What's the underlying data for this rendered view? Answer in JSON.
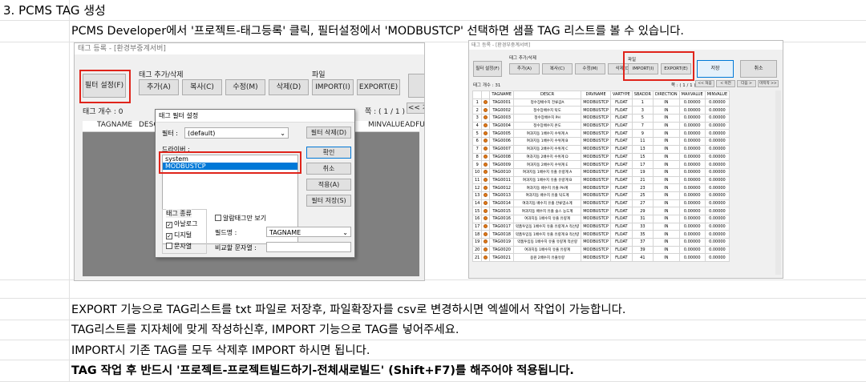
{
  "sheet": {
    "heading": "3. PCMS TAG 생성",
    "intro": "PCMS Developer에서 '프로젝트-태그등록' 클릭, 필터설정에서 'MODBUSTCP' 선택하면 샘플 TAG 리스트를 볼 수 있습니다.",
    "notes": [
      "EXPORT 기능으로 TAG리스트를 txt 파일로 저장후, 파일확장자를 csv로 변경하시면 엑셀에서 작업이 가능합니다.",
      "TAG리스트를 지자체에 맞게 작성하신후, IMPORT 기능으로 TAG를 넣어주세요.",
      "IMPORT시 기존 TAG를 모두 삭제후 IMPORT 하시면 됩니다.",
      "TAG 작업 후 반드시 '프로젝트-프로젝트빌드하기-전체새로빌드' (Shift+F7)를 해주어야 적용됩니다."
    ]
  },
  "shot1": {
    "window_title": "태그 등록 - [환경부중계서버]",
    "filter_button": "필터 설정(F)",
    "group_tag": "태그 추가/삭제",
    "btn_add": "추가(A)",
    "btn_copy": "복사(C)",
    "btn_edit": "수정(M)",
    "btn_delete": "삭제(D)",
    "group_file": "파일",
    "btn_import": "IMPORT(I)",
    "btn_export": "EXPORT(E)",
    "tag_count": "태그 개수 : 0",
    "page": "쪽 : ( 1 / 1 )",
    "first_btn": "<< 처",
    "col_tagname": "TAGNAME",
    "col_descr": "DESCR",
    "col_minvalue": "MINVALUE",
    "col_adfull": "ADFU",
    "dialog": {
      "title": "태그 필터 설정",
      "filter_label": "필터 :",
      "filter_value": "(default)",
      "btn_filter_delete": "필터 삭제(D)",
      "driver_label": "드라이버 :",
      "drivers": [
        "system",
        "MODBUSTCP"
      ],
      "btn_ok": "확인",
      "btn_cancel": "취소",
      "btn_apply": "적용(A)",
      "btn_filter_save": "필터 저장(S)",
      "tag_kind": "태그 종류",
      "kind_analog": "아날로그",
      "kind_digital": "디지털",
      "kind_string": "문자열",
      "alarm_only": "알람태그만 보기",
      "field_name_label": "필드명 :",
      "field_name_value": "TAGNAME",
      "compare_label": "비교할 문자열 :"
    }
  },
  "shot2": {
    "window_title": "태그 등록 - [환경부중계서버]",
    "filter_button": "필터 설정(F)",
    "group_tag": "태그 추가/삭제",
    "btn_add": "추가(A)",
    "btn_copy": "복사(C)",
    "btn_edit": "수정(M)",
    "btn_delete": "삭제(D)",
    "group_file": "파일",
    "btn_import": "IMPORT(I)",
    "btn_export": "EXPORT(E)",
    "btn_save": "저장",
    "btn_cancel": "취소",
    "tag_count": "태그 개수 : 31",
    "page": "쪽 : ( 1 / 1 )",
    "nav": [
      "<< 처음",
      "< 이전",
      "다음 >",
      "마지막 >>"
    ],
    "columns": [
      "",
      "",
      "TAGNAME",
      "DESCR",
      "DRVNAME",
      "VARTYPE",
      "SBADDR",
      "DIRECTION",
      "MAXVALUE",
      "MINVALUE"
    ],
    "rows": [
      [
        "1",
        "TAG0001",
        "정수장배수지 전류값A",
        "MODBUSTCP",
        "FLOAT",
        "1",
        "IN",
        "0.00000",
        "0.00000"
      ],
      [
        "2",
        "TAG0002",
        "정수장배수지 탁도",
        "MODBUSTCP",
        "FLOAT",
        "3",
        "IN",
        "0.00000",
        "0.00000"
      ],
      [
        "3",
        "TAG0003",
        "정수장배수지 PH",
        "MODBUSTCP",
        "FLOAT",
        "5",
        "IN",
        "0.00000",
        "0.00000"
      ],
      [
        "4",
        "TAG0004",
        "정수장배수지 온도",
        "MODBUSTCP",
        "FLOAT",
        "7",
        "IN",
        "0.00000",
        "0.00000"
      ],
      [
        "5",
        "TAG0005",
        "여과지동 1배수지 수위계 A",
        "MODBUSTCP",
        "FLOAT",
        "9",
        "IN",
        "0.00000",
        "0.00000"
      ],
      [
        "6",
        "TAG0006",
        "여과지동 1배수지 수위계 B",
        "MODBUSTCP",
        "FLOAT",
        "11",
        "IN",
        "0.00000",
        "0.00000"
      ],
      [
        "7",
        "TAG0007",
        "여과지동 2배수지 수위계 C",
        "MODBUSTCP",
        "FLOAT",
        "13",
        "IN",
        "0.00000",
        "0.00000"
      ],
      [
        "8",
        "TAG0008",
        "여과지동 2배수지 수위계 D",
        "MODBUSTCP",
        "FLOAT",
        "15",
        "IN",
        "0.00000",
        "0.00000"
      ],
      [
        "9",
        "TAG0009",
        "여과지동 2배수지 수위계 E",
        "MODBUSTCP",
        "FLOAT",
        "17",
        "IN",
        "0.00000",
        "0.00000"
      ],
      [
        "10",
        "TAG0010",
        "여과지동 1배수지 유출 유량계 A",
        "MODBUSTCP",
        "FLOAT",
        "19",
        "IN",
        "0.00000",
        "0.00000"
      ],
      [
        "11",
        "TAG0011",
        "여과지동 1배수지 유출 유량계 B",
        "MODBUSTCP",
        "FLOAT",
        "21",
        "IN",
        "0.00000",
        "0.00000"
      ],
      [
        "12",
        "TAG0012",
        "여과지동 배수지 유출 PH계",
        "MODBUSTCP",
        "FLOAT",
        "23",
        "IN",
        "0.00000",
        "0.00000"
      ],
      [
        "13",
        "TAG0013",
        "여과지동 배수지 유출 탁도계",
        "MODBUSTCP",
        "FLOAT",
        "25",
        "IN",
        "0.00000",
        "0.00000"
      ],
      [
        "14",
        "TAG0014",
        "여과지동 배수지 유출 잔류염소계",
        "MODBUSTCP",
        "FLOAT",
        "27",
        "IN",
        "0.00000",
        "0.00000"
      ],
      [
        "15",
        "TAG0015",
        "여과지동 배수지 유출 술스 농도계",
        "MODBUSTCP",
        "FLOAT",
        "29",
        "IN",
        "0.00000",
        "0.00000"
      ],
      [
        "16",
        "TAG0016",
        "여과지동 1배수지 유출 유량계",
        "MODBUSTCP",
        "FLOAT",
        "31",
        "IN",
        "0.00000",
        "0.00000"
      ],
      [
        "17",
        "TAG0017",
        "약품투입동 1배수지 유출 유량계 A 적산량",
        "MODBUSTCP",
        "FLOAT",
        "33",
        "IN",
        "0.00000",
        "0.00000"
      ],
      [
        "18",
        "TAG0018",
        "약품투입동 1배수지 유출 유량계 B 적산량",
        "MODBUSTCP",
        "FLOAT",
        "35",
        "IN",
        "0.00000",
        "0.00000"
      ],
      [
        "19",
        "TAG0019",
        "약품투입동 1배수지 유출 유량계 적산량",
        "MODBUSTCP",
        "FLOAT",
        "37",
        "IN",
        "0.00000",
        "0.00000"
      ],
      [
        "20",
        "TAG0020",
        "여과지동 1배수지 유출 유량계",
        "MODBUSTCP",
        "FLOAT",
        "39",
        "IN",
        "0.00000",
        "0.00000"
      ],
      [
        "21",
        "TAG0021",
        "용원 2배수지 유출유량",
        "MODBUSTCP",
        "FLOAT",
        "41",
        "IN",
        "0.00000",
        "0.00000"
      ]
    ]
  },
  "colors": {
    "highlight_border": "#e0241b",
    "selection": "#0078d7",
    "status_dot": "#e07b1a"
  }
}
